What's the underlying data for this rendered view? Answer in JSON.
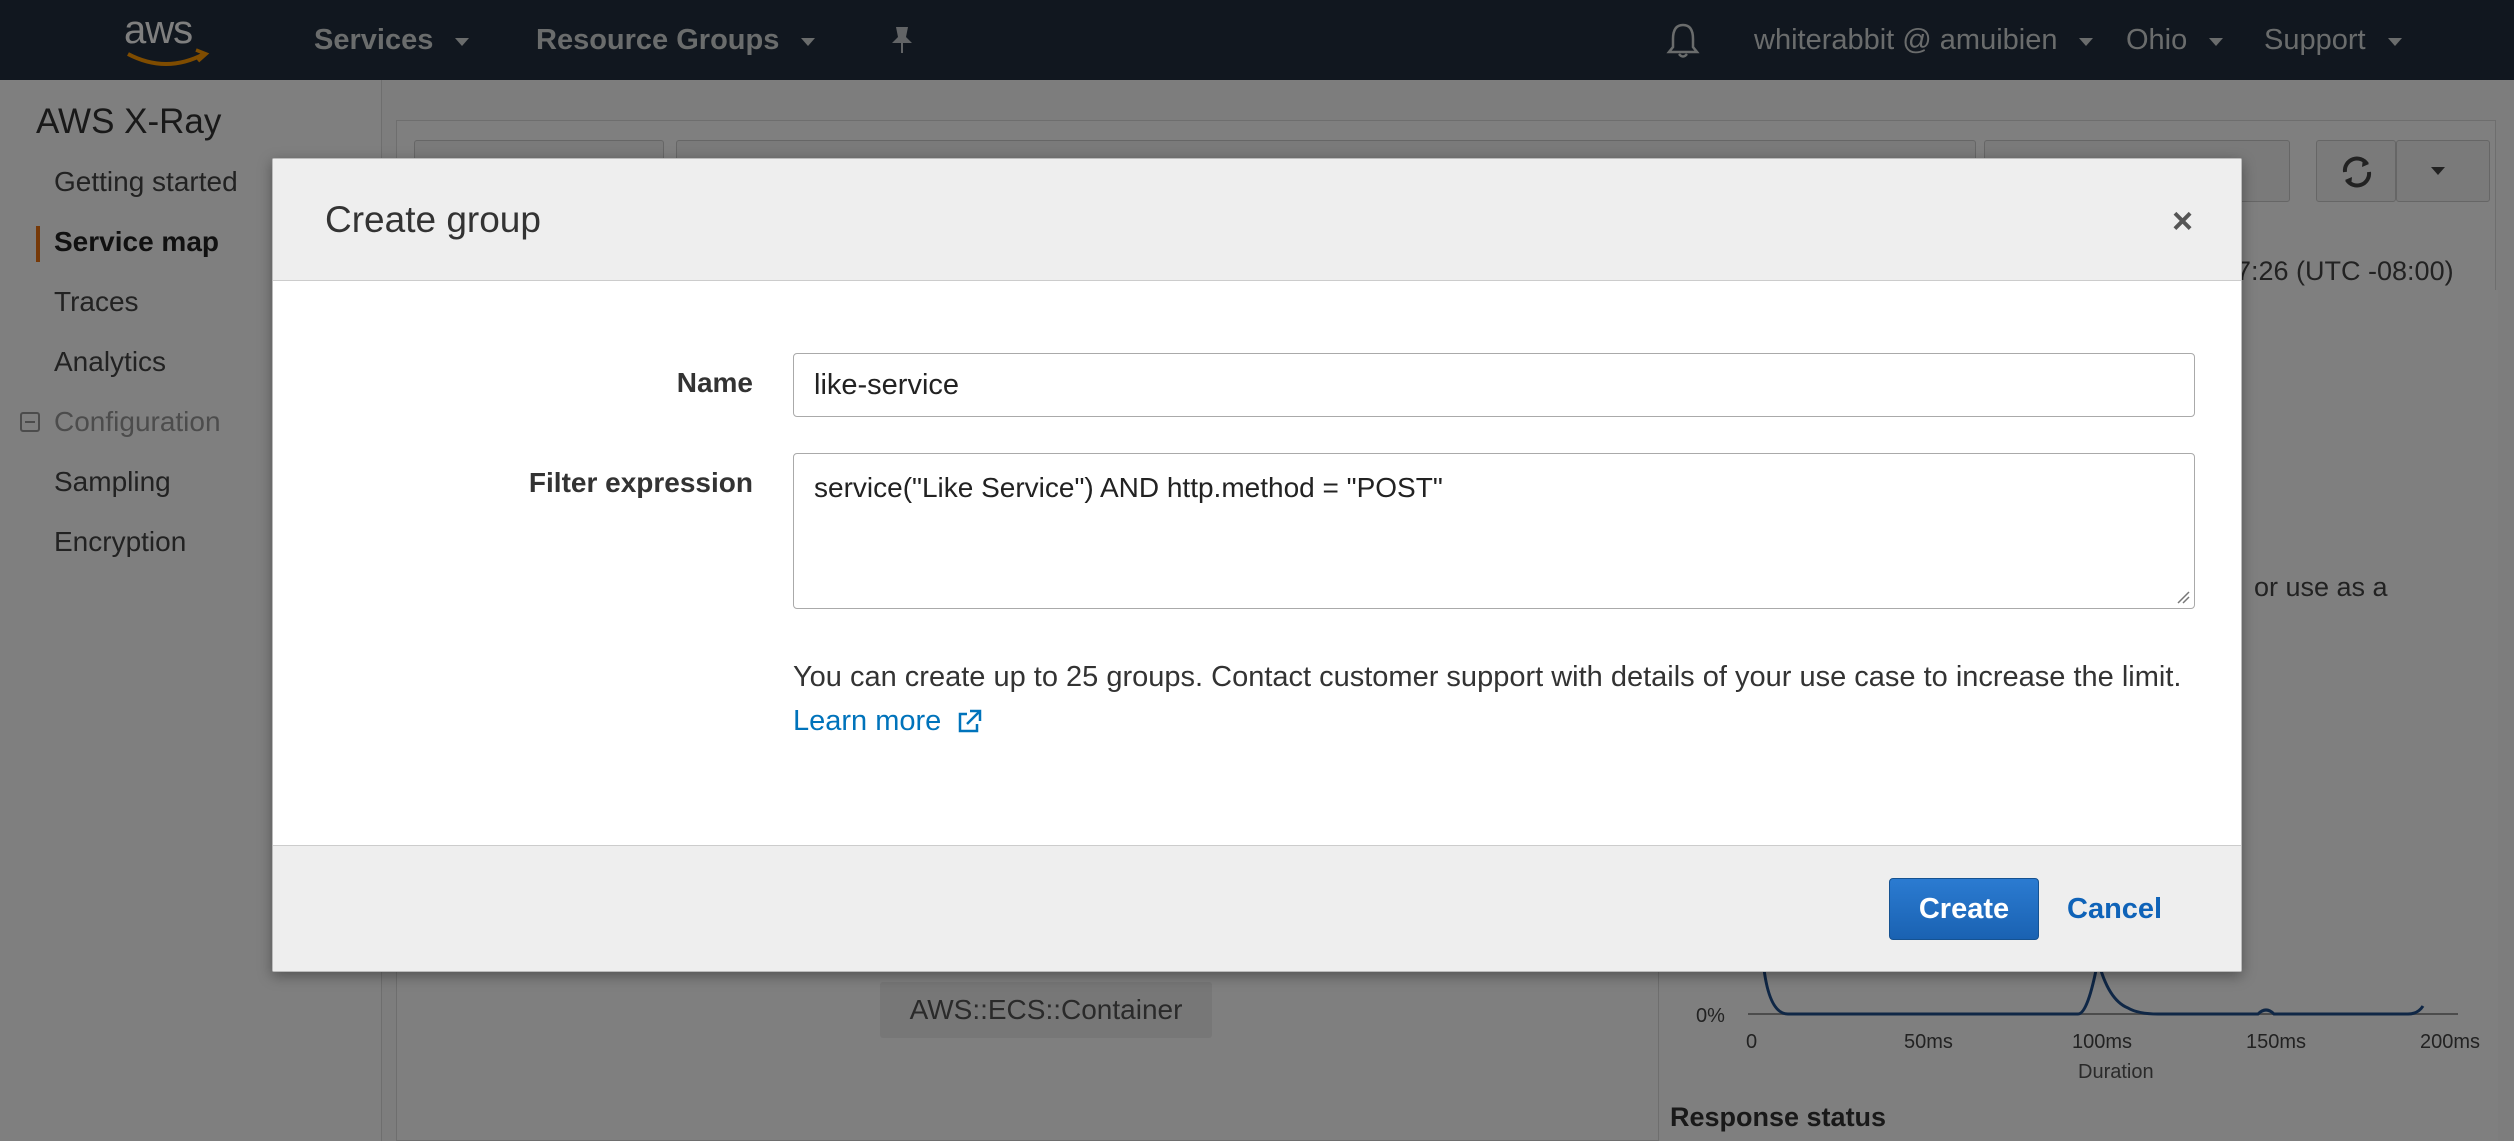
{
  "topnav": {
    "logo_text": "aws",
    "services": "Services",
    "resource_groups": "Resource Groups",
    "account": "whiterabbit @ amuibien",
    "region": "Ohio",
    "support": "Support"
  },
  "sidebar": {
    "title": "AWS X-Ray",
    "items": [
      {
        "label": "Getting started"
      },
      {
        "label": "Service map"
      },
      {
        "label": "Traces"
      },
      {
        "label": "Analytics"
      },
      {
        "label": "Configuration"
      },
      {
        "label": "Sampling"
      },
      {
        "label": "Encryption"
      }
    ]
  },
  "background": {
    "time_text": "7:26 (UTC -08:00)",
    "side_text": "or use as a",
    "ecs_label": "AWS::ECS::Container",
    "chart_ytick": "0%",
    "chart_xticks": [
      "0",
      "50ms",
      "100ms",
      "150ms",
      "200ms"
    ],
    "chart_xlabel": "Duration",
    "response_status": "Response status"
  },
  "modal": {
    "title": "Create group",
    "close_glyph": "×",
    "name_label": "Name",
    "name_value": "like-service",
    "filter_label": "Filter expression",
    "filter_value": "service(\"Like Service\") AND http.method = \"POST\"",
    "help_text": "You can create up to 25 groups. Contact customer support with details of your use case to increase the limit.",
    "learn_more": "Learn more",
    "create_label": "Create",
    "cancel_label": "Cancel"
  }
}
